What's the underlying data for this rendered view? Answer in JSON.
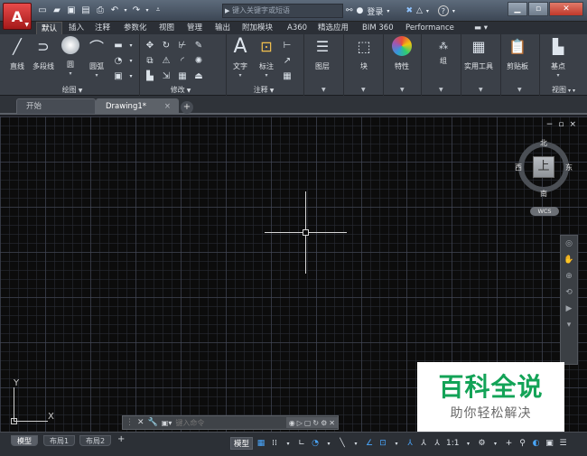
{
  "window": {
    "app_button_glyph": "A",
    "search_placeholder": "键入关键字或短语",
    "login_label": "登录",
    "help_label": "?"
  },
  "quick_access": [
    "new-icon",
    "open-icon",
    "save-icon",
    "saveas-icon",
    "plot-icon",
    "undo-icon",
    "redo-icon",
    "dropdown-icon"
  ],
  "ribbon_tabs": [
    "默认",
    "插入",
    "注释",
    "参数化",
    "视图",
    "管理",
    "输出",
    "附加模块",
    "A360",
    "精选应用",
    "BIM 360",
    "Performance"
  ],
  "ribbon_active_tab": "默认",
  "ribbon": {
    "draw": {
      "title": "绘图",
      "line": "直线",
      "polyline": "多段线",
      "circle": "圆",
      "arc": "圆弧"
    },
    "modify": {
      "title": "修改"
    },
    "annotation": {
      "title": "注释",
      "text": "文字",
      "dimension": "标注"
    },
    "layers": "图层",
    "block": "块",
    "properties": "特性",
    "groups": "组",
    "utilities": "实用工具",
    "clipboard": "剪贴板",
    "view": {
      "title": "视图",
      "base": "基点"
    }
  },
  "doc_tabs": {
    "start": "开始",
    "drawing": "Drawing1*",
    "close_glyph": "×",
    "add_glyph": "+"
  },
  "viewport": {
    "minimize": "−",
    "restore": "▫",
    "close": "×"
  },
  "viewcube": {
    "top_face": "上",
    "north": "北",
    "south": "南",
    "east": "东",
    "west": "西",
    "wcs": "WCS"
  },
  "ucs": {
    "x": "X",
    "y": "Y"
  },
  "command_line": {
    "placeholder": "键入命令"
  },
  "watermark": {
    "title": "百科全说",
    "subtitle": "助你轻松解决"
  },
  "layout_tabs": [
    "模型",
    "布局1",
    "布局2"
  ],
  "layout_active": "模型",
  "status": {
    "model": "模型",
    "scale": "1:1"
  },
  "colors": {
    "accent_red": "#c0392b",
    "canvas_bg": "#0c0c0c",
    "watermark_green": "#13a357"
  }
}
